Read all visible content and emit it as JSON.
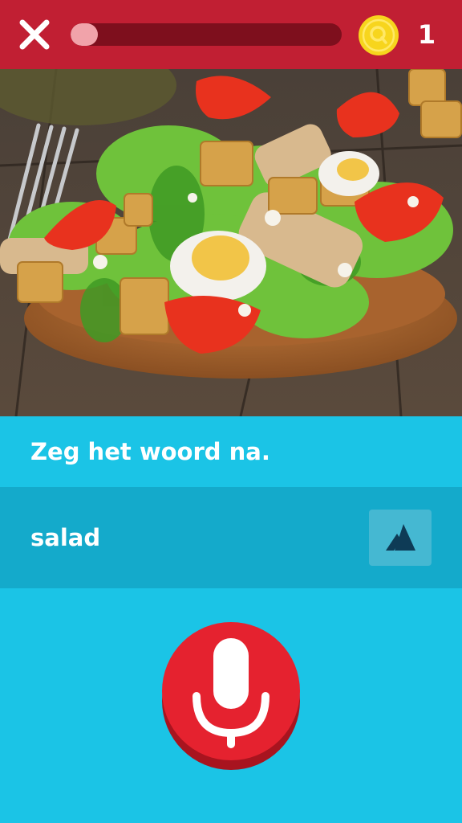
{
  "header": {
    "progress_fraction": 0.1,
    "coin_count": "1",
    "close_icon": "close-icon",
    "coin_icon": "coin-icon"
  },
  "lesson": {
    "instruction": "Zeg het woord na.",
    "word": "salad",
    "audio_icon": "slow-audio-icon",
    "mic_icon": "microphone-icon"
  },
  "colors": {
    "header_red": "#c11f33",
    "progress_track": "#7e0f1d",
    "progress_fill": "#f1a3aa",
    "coin_yellow": "#f7d51d",
    "background_blue": "#1bc4e6",
    "word_row_blue": "#14aacb",
    "mic_red": "#e5222f"
  }
}
